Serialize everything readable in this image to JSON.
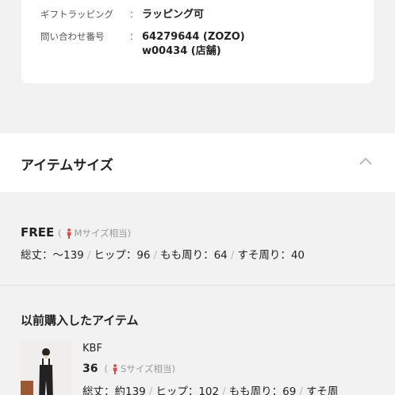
{
  "info": {
    "rows": [
      {
        "key": "ギフトラッピング",
        "sep": "：",
        "values": [
          "ラッピング可"
        ]
      },
      {
        "key": "問い合わせ番号",
        "sep": "：",
        "values": [
          "64279644 (ZOZO)",
          "w00434 (店舗)"
        ]
      }
    ]
  },
  "item_size_section": {
    "title": "アイテムサイズ",
    "chevron": "chevron-up-icon"
  },
  "size": {
    "name": "FREE",
    "hint_open": "(",
    "hint_text": "Mサイズ相当",
    "hint_close": ")",
    "measurements": [
      {
        "label": "総丈：〜139"
      },
      {
        "label": "ヒップ：96"
      },
      {
        "label": "もも周り：64"
      },
      {
        "label": "すそ周り：40"
      }
    ],
    "separator": "/"
  },
  "previous": {
    "title": "以前購入したアイテム",
    "brand": "KBF",
    "size": "36",
    "hint_open": "(",
    "hint_text": "Sサイズ相当",
    "hint_close": ")",
    "measurements": [
      {
        "label": "総丈：約139"
      },
      {
        "label": "ヒップ：102"
      },
      {
        "label": "もも周り：69"
      },
      {
        "label": "すそ周"
      }
    ],
    "separator": "/"
  },
  "colors": {
    "accent_person": "#e04a4a",
    "muted": "#999999",
    "background": "#f2f2f2"
  }
}
